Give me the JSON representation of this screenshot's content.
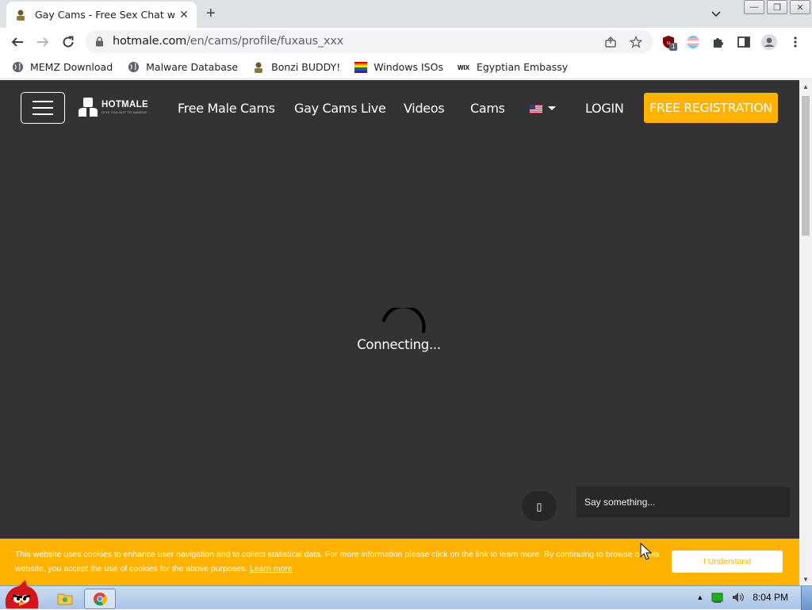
{
  "browser": {
    "tab": {
      "title": "Gay Cams - Free Sex Chat with",
      "close": "✕"
    },
    "new_tab": "+",
    "window_controls": {
      "minimize": "—",
      "restore": "❐",
      "close": "✕"
    },
    "url": {
      "host": "hotmale.com",
      "path": "/en/cams/profile/fuxaus_xxx"
    },
    "extension_badge": "1",
    "bookmarks": [
      {
        "label": "MEMZ Download",
        "icon": "globe-icon"
      },
      {
        "label": "Malware Database",
        "icon": "globe-icon"
      },
      {
        "label": "Bonzi BUDDY!",
        "icon": "bonzi-icon"
      },
      {
        "label": "Windows ISOs",
        "icon": "rainbow-flag-icon"
      },
      {
        "label": "Egyptian Embassy",
        "icon": "wix-icon"
      }
    ]
  },
  "site": {
    "logo": {
      "name": "HOTMALE",
      "tagline": "GIVE YOU NOT TO HANDLE"
    },
    "nav": [
      "Free Male Cams",
      "Gay Cams Live",
      "Videos",
      "Cams"
    ],
    "login": "LOGIN",
    "register": "FREE REGISTRATION",
    "status": "Connecting...",
    "chat_placeholder": "Say something...",
    "chat_icon_glyph": "▯",
    "cookie": {
      "text": "This website uses cookies to enhance user navigation and to collect statistical data. For more information please click on the link to learn more. By continuing to browse on this website, you accept the use of cookies for the above purposes.",
      "link": "Learn more",
      "button": "I Understand"
    },
    "colors": {
      "page_bg": "#333333",
      "accent": "#ffb300"
    }
  },
  "taskbar": {
    "clock": "8:04 PM"
  }
}
